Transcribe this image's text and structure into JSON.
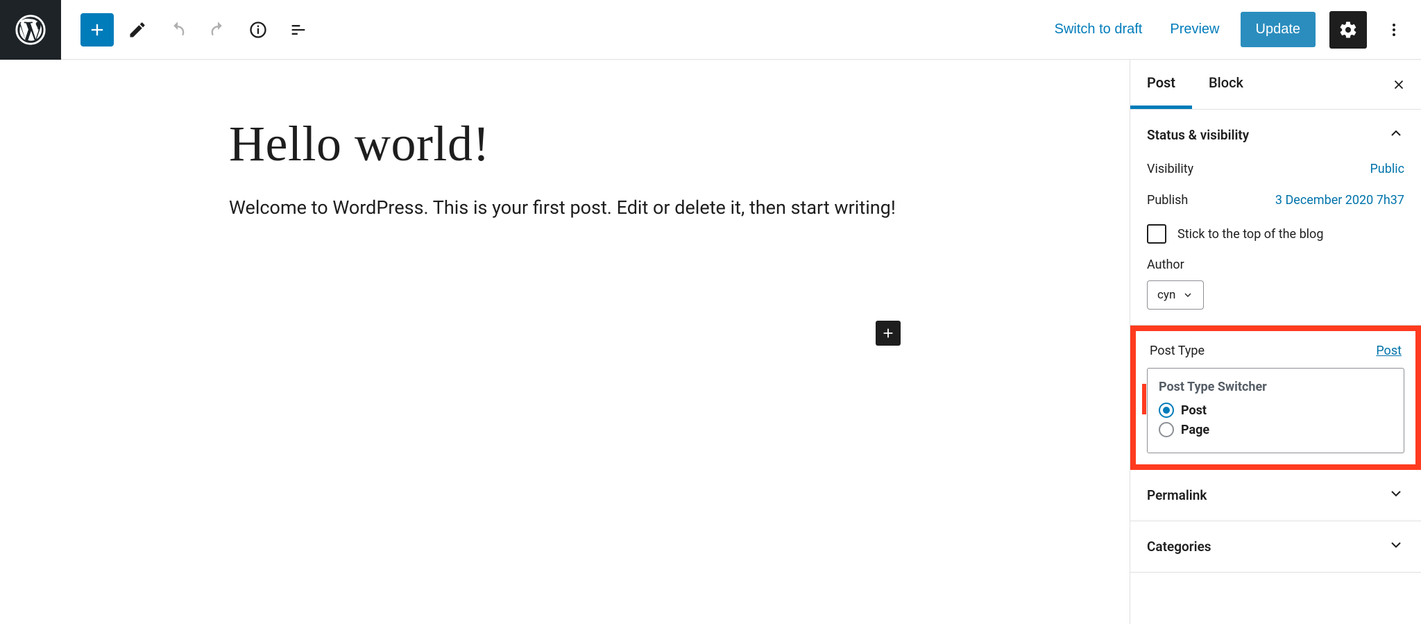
{
  "toolbar": {
    "switch_to_draft": "Switch to draft",
    "preview": "Preview",
    "update": "Update"
  },
  "editor": {
    "title": "Hello world!",
    "body": "Welcome to WordPress. This is your first post. Edit or delete it, then start writing!"
  },
  "sidebar": {
    "tabs": {
      "post": "Post",
      "block": "Block"
    },
    "status_section": {
      "heading": "Status & visibility",
      "visibility_label": "Visibility",
      "visibility_value": "Public",
      "publish_label": "Publish",
      "publish_value": "3 December 2020 7h37",
      "stick_label": "Stick to the top of the blog",
      "author_label": "Author",
      "author_value": "cyn"
    },
    "post_type": {
      "heading": "Post Type",
      "link": "Post",
      "switcher_title": "Post Type Switcher",
      "opt_post": "Post",
      "opt_page": "Page"
    },
    "permalink": "Permalink",
    "categories": "Categories"
  }
}
